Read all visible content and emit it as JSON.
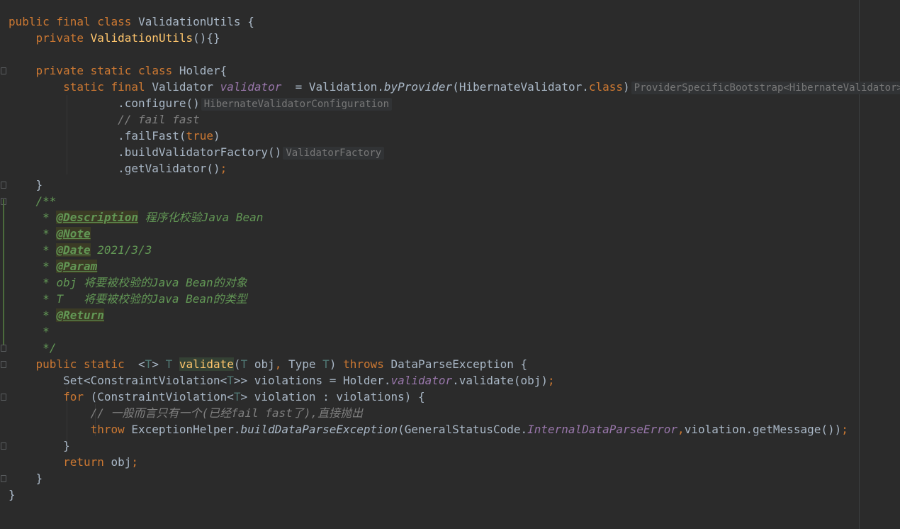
{
  "code": {
    "class_decl": {
      "kw1": "public",
      "kw2": "final",
      "kw3": "class",
      "name": "ValidationUtils",
      "rest": " {"
    },
    "ctor": {
      "kw": "private",
      "name": "ValidationUtils",
      "rest": "(){}"
    },
    "holder_decl": {
      "kw1": "private",
      "kw2": "static",
      "kw3": "class",
      "name": "Holder{"
    },
    "validator_field": {
      "kw1": "static",
      "kw2": "final",
      "type": "Validator",
      "field": "validator",
      "assign": "  = Validation.",
      "method": "byProvider",
      "arg": "(HibernateValidator.",
      "cls_kw": "class",
      "close": ")",
      "hint": "ProviderSpecificBootstrap<HibernateValidator>"
    },
    "configure": {
      "text": ".configure()",
      "hint": "HibernateValidatorConfiguration"
    },
    "fail_comment": "// fail fast",
    "fail_fast": {
      "pre": ".failFast(",
      "kw": "true",
      "post": ")"
    },
    "build_factory": {
      "text": ".buildValidatorFactory()",
      "hint": "ValidatorFactory"
    },
    "get_validator": {
      "text": ".getValidator()",
      "semi": ";"
    },
    "holder_close": "}",
    "javadoc": {
      "open": "/**",
      "desc_tag": "@Description",
      "desc_text": " 程序化校验Java Bean",
      "note_tag": "@Note",
      "date_tag": "@Date",
      "date_text": " 2021/3/3",
      "param_tag": "@Param",
      "obj_line": "obj 将要被校验的Java Bean的对象",
      "t_line": "T   将要被校验的Java Bean的类型",
      "return_tag": "@Return",
      "star": "*",
      "close": "*/"
    },
    "method_sig": {
      "kw1": "public",
      "kw2": "static",
      "t1": "T",
      "t2": "T",
      "name": "validate",
      "t3": "T",
      "p1": " obj",
      "comma": ",",
      "p2": " Type ",
      "t4": "T",
      "close": ")",
      "throws": "throws",
      "exc": " DataParseException {"
    },
    "set_line": {
      "pre": "Set<ConstraintViolation<",
      "t": "T",
      "mid": ">> violations = Holder.",
      "field": "validator",
      "post": ".validate(obj)",
      "semi": ";"
    },
    "for_line": {
      "kw": "for",
      "pre": " (ConstraintViolation<",
      "t": "T",
      "post": "> violation : violations) {"
    },
    "throw_comment": "// 一般而言只有一个(已经fail fast了),直接抛出",
    "throw_line": {
      "kw": "throw",
      "pre": " ExceptionHelper.",
      "method": "buildDataParseException",
      "arg": "(GeneralStatusCode.",
      "const": "InternalDataParseError",
      "comma": ",",
      "post": "violation.getMessage())",
      "semi": ";"
    },
    "for_close": "}",
    "return_line": {
      "kw": "return",
      "val": " obj",
      "semi": ";"
    },
    "method_close": "}",
    "class_close": "}"
  },
  "colors": {
    "background": "#2b2b2b",
    "keyword": "#cc7832",
    "method_decl": "#ffc66d",
    "field": "#9876aa",
    "doc_comment": "#629755",
    "line_comment": "#808080",
    "text": "#a9b7c6"
  }
}
